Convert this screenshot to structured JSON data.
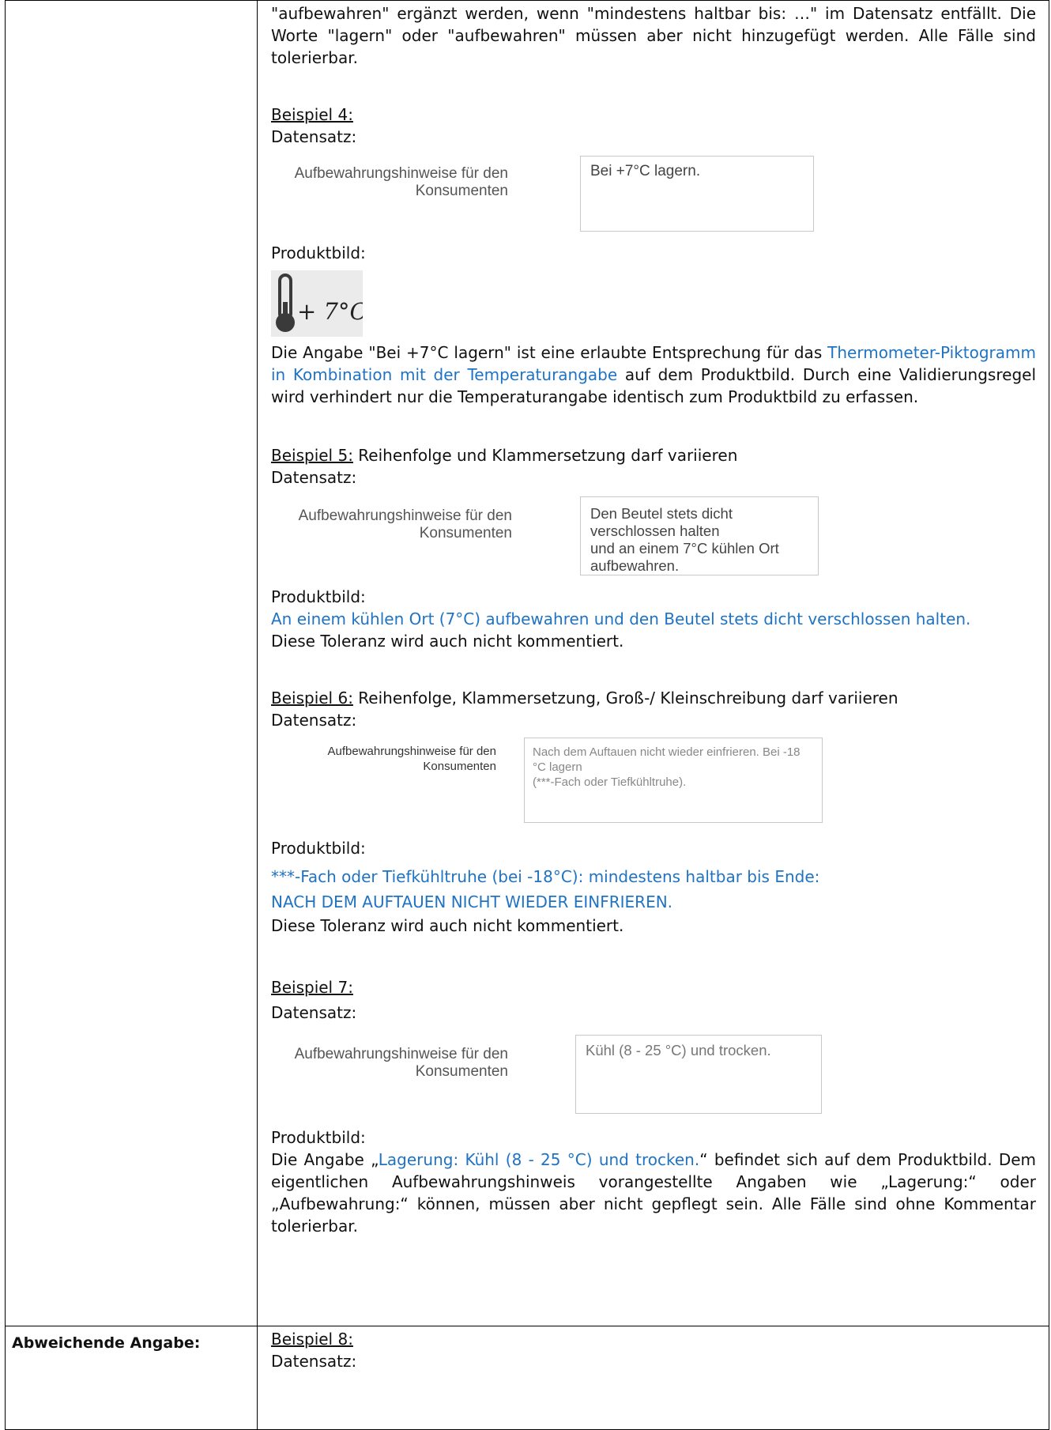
{
  "intro": "\"aufbewahren\" ergänzt werden, wenn \"mindestens haltbar bis: …\" im Datensatz entfällt. Die Worte \"lagern\" oder \"aufbewahren\" müssen aber nicht hinzugefügt werden. Alle Fälle sind tolerierbar.",
  "common": {
    "datensatz": "Datensatz:",
    "produktbild": "Produktbild:",
    "field_label_1": "Aufbewahrungshinweise für den",
    "field_label_2": "Konsumenten"
  },
  "ex4": {
    "title": "Beispiel 4:",
    "field_value": "Bei +7°C lagern.",
    "pictogram_text": "+ 7°C",
    "text_a": "Die Angabe \"Bei +7°C lagern\" ist eine erlaubte Entsprechung für das ",
    "text_blue": "Thermometer-Piktogramm in Kombination mit der Temperaturangabe",
    "text_b": " auf dem Produktbild. Durch eine Validierungsregel wird verhindert nur die Temperaturangabe identisch zum Produktbild zu erfassen."
  },
  "ex5": {
    "title": "Beispiel 5:",
    "subtitle": " Reihenfolge und Klammersetzung darf variieren",
    "field_line_1": "Den Beutel stets dicht verschlossen halten",
    "field_line_2": "und an einem 7°C kühlen Ort aufbewahren.",
    "product_text": "An einem kühlen Ort (7°C) aufbewahren und den Beutel stets dicht verschlossen halten.",
    "note": "Diese Toleranz wird auch nicht kommentiert."
  },
  "ex6": {
    "title": "Beispiel 6:",
    "subtitle": " Reihenfolge, Klammersetzung, Groß-/ Kleinschreibung darf variieren",
    "field_line_1": "Nach dem Auftauen nicht wieder einfrieren. Bei -18 °C lagern",
    "field_line_2": "(***-Fach oder Tiefkühltruhe).",
    "product_line_1": "***-Fach oder Tiefkühltruhe (bei -18°C): mindestens haltbar bis Ende:",
    "product_line_2": "NACH DEM AUFTAUEN NICHT WIEDER EINFRIEREN.",
    "note": "Diese Toleranz wird auch nicht kommentiert."
  },
  "ex7": {
    "title": "Beispiel 7:",
    "field_value": "Kühl (8 - 25 °C) und trocken.",
    "text_a": "Die Angabe „",
    "text_blue": "Lagerung: Kühl (8 - 25 °C) und trocken.",
    "text_b": "“ befindet sich auf dem Produktbild. Dem eigentlichen Aufbewahrungshinweis vorangestellte Angaben wie „Lagerung:“ oder „Aufbewahrung:“ können, müssen aber nicht gepflegt sein. Alle Fälle sind ohne Kommentar tolerierbar."
  },
  "row2": {
    "label": "Abweichende Angabe:",
    "title": "Beispiel 8:",
    "datensatz": "Datensatz:"
  }
}
